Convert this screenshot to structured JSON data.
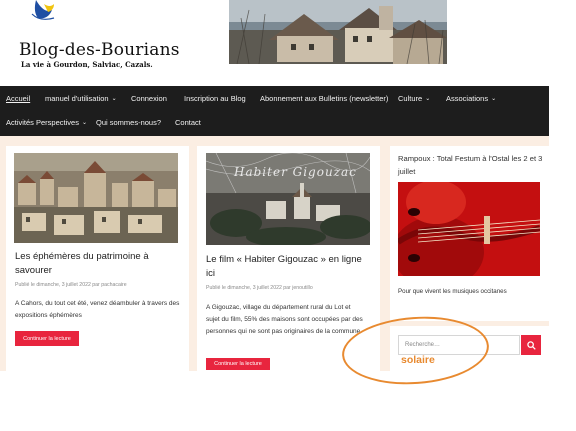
{
  "header": {
    "site_title": "Blog-des-Bourians",
    "tagline": "La vie à Gourdon, Salviac, Cazals."
  },
  "nav": {
    "row1": [
      {
        "label": "Accueil",
        "active": true,
        "has_menu": false
      },
      {
        "label": "manuel d'utilisation",
        "active": false,
        "has_menu": true
      },
      {
        "label": "Connexion",
        "active": false,
        "has_menu": false
      },
      {
        "label": "Inscription au Blog",
        "active": false,
        "has_menu": false
      },
      {
        "label": "Abonnement aux Bulletins (newsletter)",
        "active": false,
        "has_menu": false
      },
      {
        "label": "Culture",
        "active": false,
        "has_menu": true
      },
      {
        "label": "Associations",
        "active": false,
        "has_menu": true
      }
    ],
    "row2": [
      {
        "label": "Activités Perspectives",
        "active": false,
        "has_menu": true
      },
      {
        "label": "Qui sommes-nous?",
        "active": false,
        "has_menu": false
      },
      {
        "label": "Contact",
        "active": false,
        "has_menu": false
      }
    ],
    "chevron": "⌄"
  },
  "posts": [
    {
      "title": "Les éphémères du patrimoine à savourer",
      "meta": "Publié le dimanche, 3 juillet 2022 par pachacaire",
      "excerpt": "A Cahors, du tout cet été, venez déambuler à travers des expositions éphémères",
      "button": "Continuer la lecture"
    },
    {
      "image_caption": "Habiter Gigouzac",
      "title": "Le film « Habiter Gigouzac » en ligne ici",
      "meta": "Publié le dimanche, 3 juillet 2022 par jenoutillo",
      "excerpt": "A Gigouzac, village du département rural du Lot et sujet du film, 55% des maisons sont occupées par des personnes qui ne sont pas originaires de la commune.",
      "button": "Continuer la lecture"
    }
  ],
  "sidebar": {
    "widget_title": "Rampoux : Total Festum à l'Ostal les 2 et 3 juillet",
    "widget_caption": "Pour que vivent les musiques occitanes",
    "search_placeholder": "Recherche…",
    "search_icon": "search-icon"
  },
  "annotation": {
    "text": "solaire",
    "color": "#e88a30"
  },
  "colors": {
    "nav_bg": "#1d1d1d",
    "accent": "#e8253e",
    "content_bg": "#fbeee3"
  }
}
